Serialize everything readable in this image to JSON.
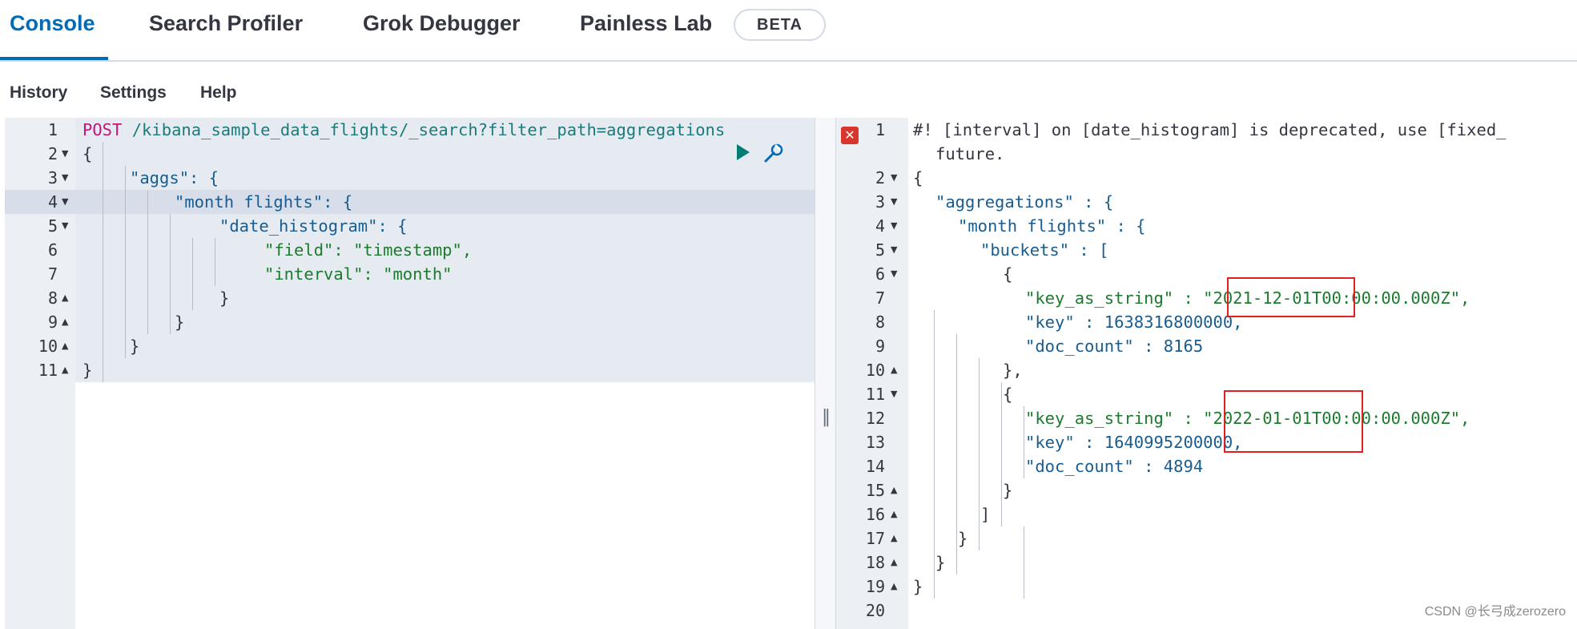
{
  "tabs": [
    {
      "label": "Console"
    },
    {
      "label": "Search Profiler"
    },
    {
      "label": "Grok Debugger"
    },
    {
      "label": "Painless Lab"
    }
  ],
  "beta_badge": "BETA",
  "menu": [
    {
      "label": "History"
    },
    {
      "label": "Settings"
    },
    {
      "label": "Help"
    }
  ],
  "request": {
    "line_numbers": [
      "1",
      "2",
      "3",
      "4",
      "5",
      "6",
      "7",
      "8",
      "9",
      "10",
      "11"
    ],
    "method": "POST",
    "url": "/kibana_sample_data_flights/_search?filter_path=aggregations",
    "lines": [
      "{",
      "\"aggs\": {",
      "\"month flights\": {",
      "\"date_histogram\": {",
      "\"field\": \"timestamp\",",
      "\"interval\": \"month\"",
      "}",
      "}",
      "}",
      "}"
    ]
  },
  "response": {
    "line_numbers": [
      "1",
      "2",
      "3",
      "4",
      "5",
      "6",
      "7",
      "8",
      "9",
      "10",
      "11",
      "12",
      "13",
      "14",
      "15",
      "16",
      "17",
      "18",
      "19",
      "20"
    ],
    "warning": "#! [interval] on [date_histogram] is deprecated, use [fixed_",
    "warning_cont": "future.",
    "lines": [
      "{",
      "\"aggregations\" : {",
      "\"month flights\" : {",
      "\"buckets\" : [",
      "{",
      "\"key_as_string\" : \"2021-12-01T00:00:00.000Z\",",
      "\"key\" : 1638316800000,",
      "\"doc_count\" : 8165",
      "},",
      "{",
      "\"key_as_string\" : \"2022-01-01T00:00:00.000Z\",",
      "\"key\" : 1640995200000,",
      "\"doc_count\" : 4894",
      "}",
      "]",
      "}",
      "}",
      "}"
    ]
  },
  "watermark": "CSDN @长弓成zerozero"
}
